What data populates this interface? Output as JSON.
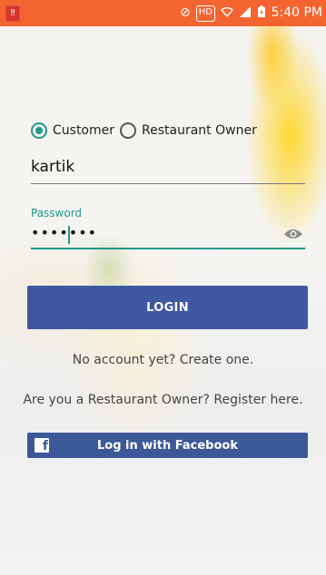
{
  "status_bar": {
    "time": "5:40 PM",
    "hd_label": "HD",
    "icons": [
      "mute-icon",
      "hd-icon",
      "wifi-icon",
      "signal-icon",
      "battery-icon"
    ],
    "color": "#f46430"
  },
  "role_selector": {
    "options": [
      {
        "label": "Customer",
        "selected": true
      },
      {
        "label": "Restaurant Owner",
        "selected": false
      }
    ]
  },
  "username": {
    "value": "kartik"
  },
  "password": {
    "label": "Password",
    "value": "•••••••",
    "toggle_icon": "eye-icon"
  },
  "login_button": {
    "label": "LOGIN"
  },
  "signup_link": {
    "label": "No account yet? Create one."
  },
  "owner_register_link": {
    "label": "Are you a Restaurant Owner? Register here."
  },
  "facebook_button": {
    "label": "Log in with Facebook",
    "icon": "facebook-icon"
  },
  "colors": {
    "accent": "#1d9a8c",
    "login_button": "#3e58a2",
    "facebook": "#3b5998"
  }
}
